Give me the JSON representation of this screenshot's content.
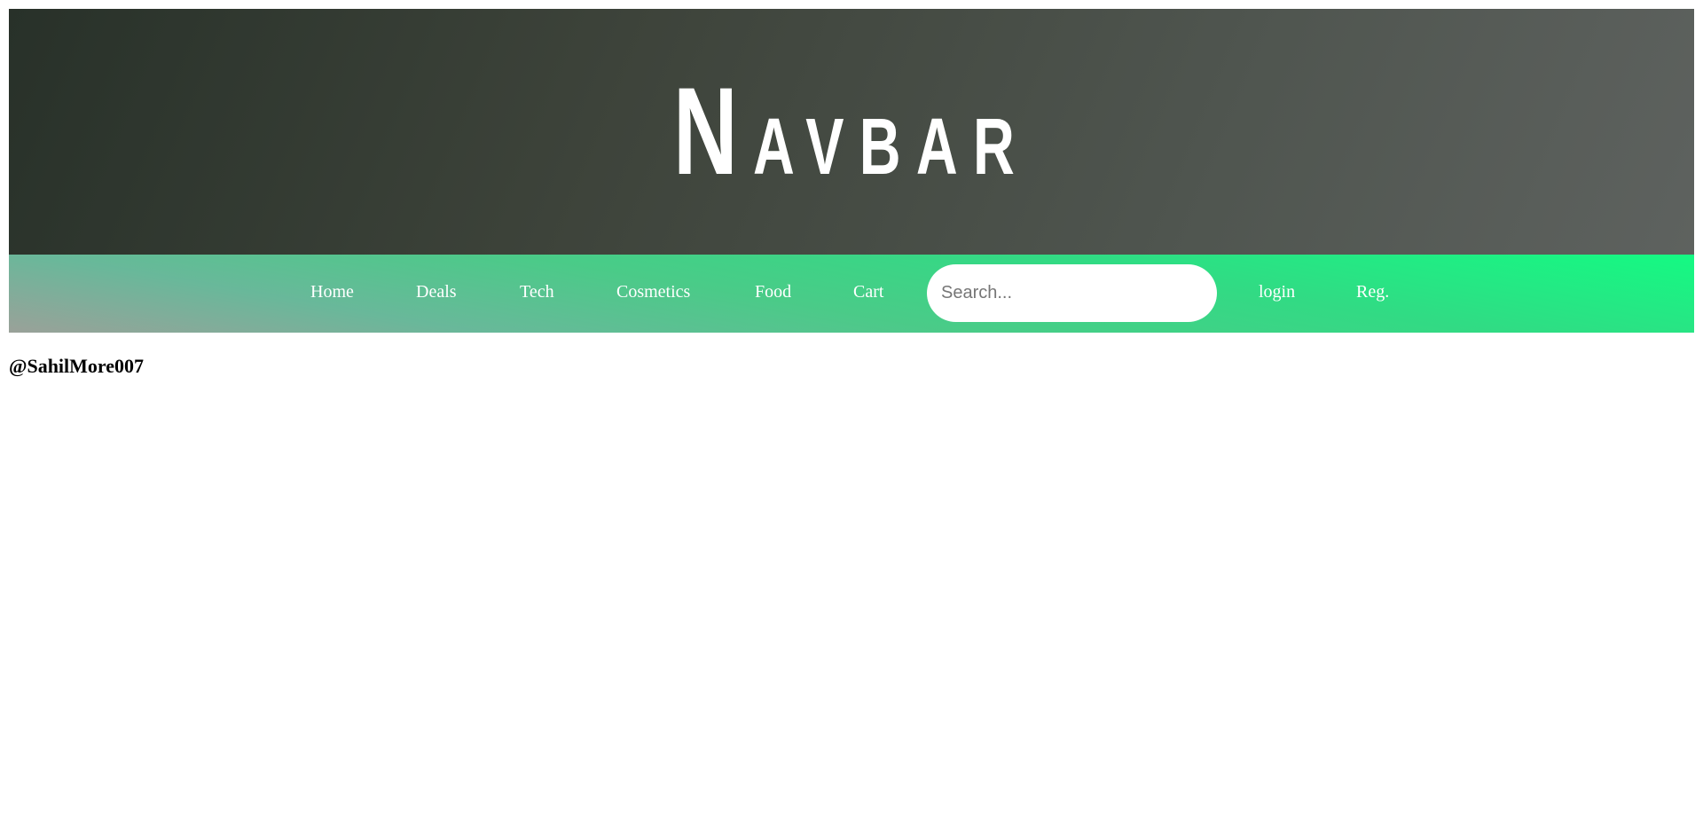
{
  "header": {
    "brand_first_letter": "N",
    "brand_rest": "AVBAR"
  },
  "nav": {
    "links": [
      {
        "label": "Home"
      },
      {
        "label": "Deals"
      },
      {
        "label": "Tech"
      },
      {
        "label": "Cosmetics"
      },
      {
        "label": "Food"
      },
      {
        "label": "Cart"
      }
    ],
    "search": {
      "placeholder": "Search...",
      "value": ""
    },
    "login_label": "login",
    "register_label": "Reg."
  },
  "footer": {
    "credit": "@SahilMore007"
  },
  "colors": {
    "banner_dark": "#283129",
    "banner_light": "#5e625f",
    "navbar_green": "#14fa83",
    "navbar_grey": "#9aa199",
    "text_white": "#ffffff"
  }
}
